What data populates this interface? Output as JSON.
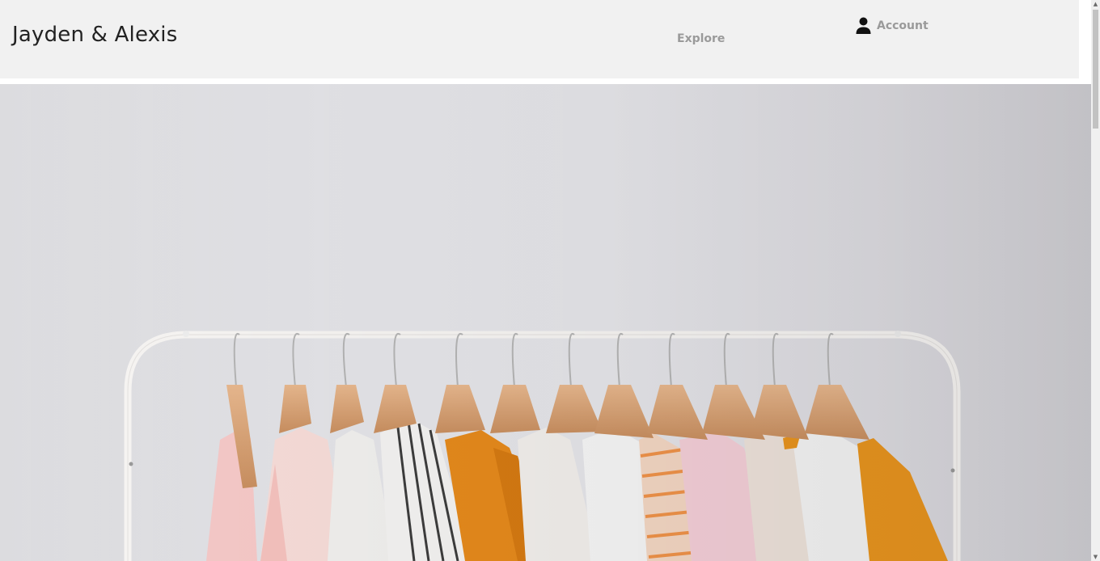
{
  "header": {
    "brand": "Jayden & Alexis",
    "nav": {
      "explore_label": "Explore",
      "account_label": "Account",
      "account_icon": "user-icon"
    }
  },
  "hero": {
    "image_subject": "clothing rack with garments on wooden hangers"
  },
  "colors": {
    "header_bg": "#f1f1f1",
    "brand_text": "#222222",
    "nav_text": "#9a9a9a",
    "account_icon": "#111111"
  },
  "scrollbar": {
    "up_icon": "scroll-up-arrow-icon",
    "down_icon": "scroll-down-arrow-icon"
  }
}
